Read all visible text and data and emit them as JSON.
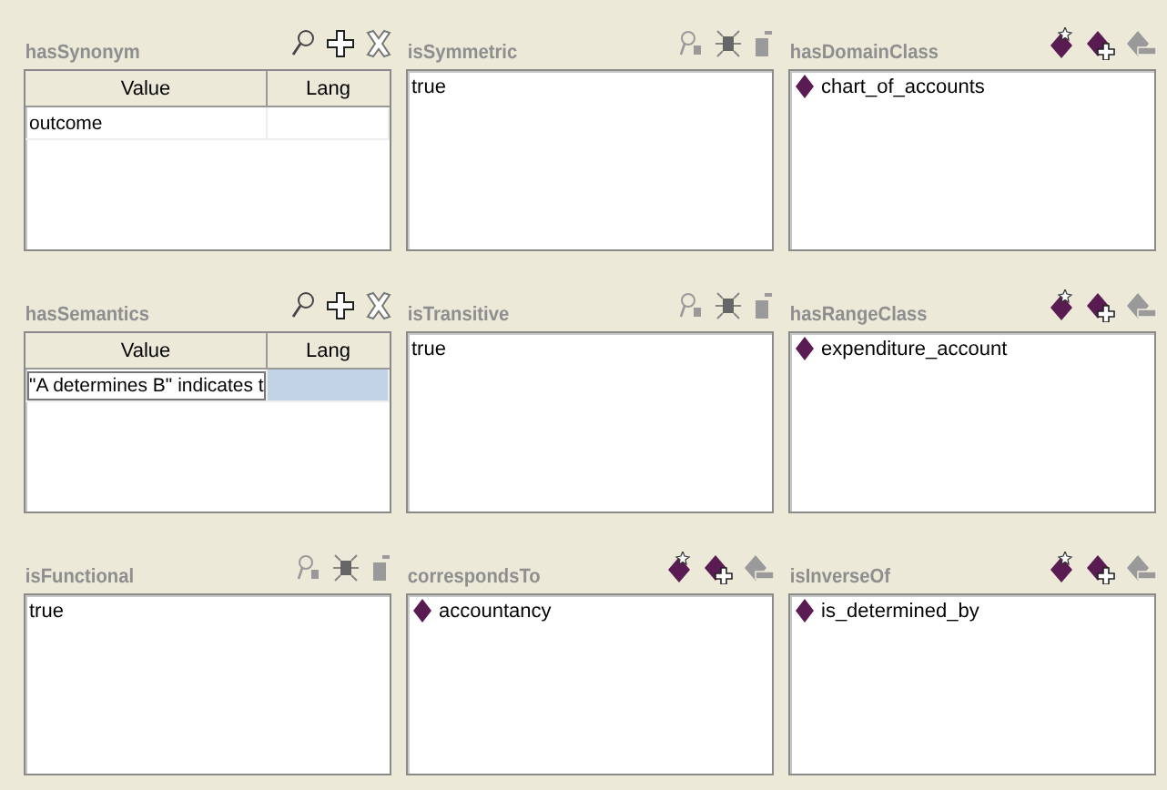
{
  "panels": [
    {
      "kind": "table",
      "title": "hasSynonym",
      "columns": [
        "Value",
        "Lang"
      ],
      "rows": [
        {
          "value": "outcome",
          "selected": false
        }
      ]
    },
    {
      "kind": "value",
      "title": "isSymmetric",
      "value": "true"
    },
    {
      "kind": "list",
      "title": "hasDomainClass",
      "items": [
        "chart_of_accounts"
      ]
    },
    {
      "kind": "table",
      "title": "hasSemantics",
      "columns": [
        "Value",
        "Lang"
      ],
      "rows": [
        {
          "value": "\"A determines B\" indicates t",
          "selected": true
        }
      ]
    },
    {
      "kind": "value",
      "title": "isTransitive",
      "value": "true"
    },
    {
      "kind": "list",
      "title": "hasRangeClass",
      "items": [
        "expenditure_account"
      ]
    },
    {
      "kind": "value",
      "title": "isFunctional",
      "value": "true"
    },
    {
      "kind": "list",
      "title": "correspondsTo",
      "items": [
        "accountancy"
      ]
    },
    {
      "kind": "list",
      "title": "isInverseOf",
      "items": [
        "is_determined_by"
      ]
    }
  ]
}
